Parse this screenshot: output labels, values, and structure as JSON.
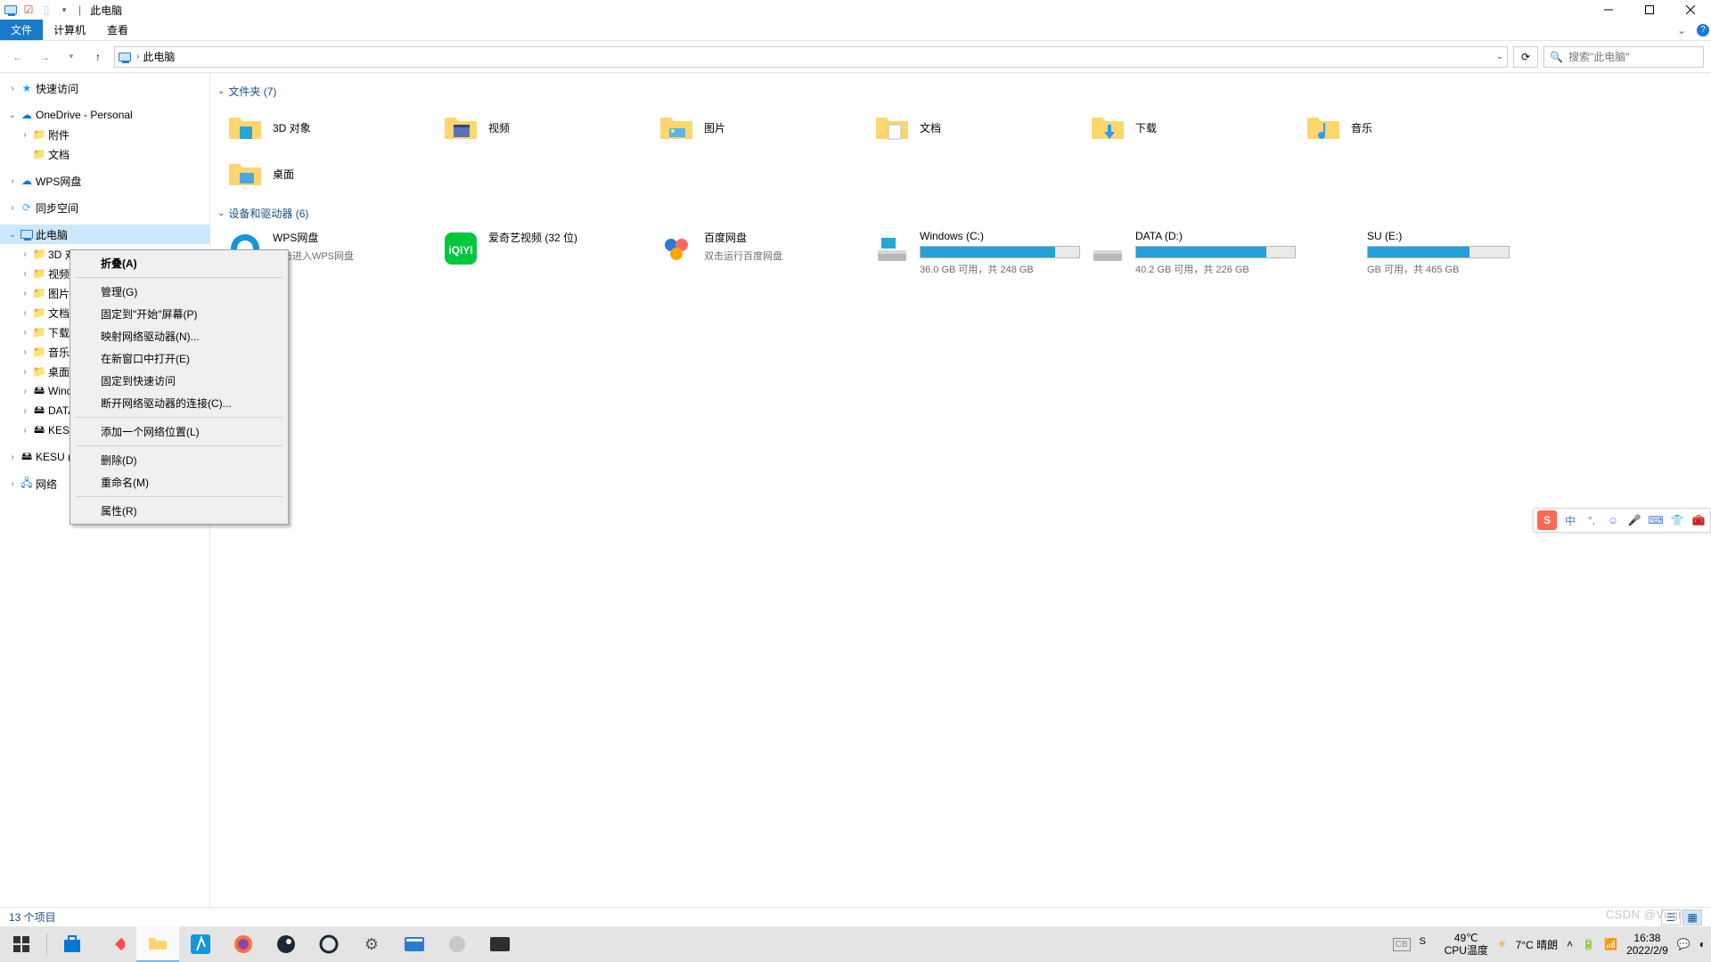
{
  "window": {
    "title": "此电脑",
    "separator": "|"
  },
  "winctl": {
    "min": "min",
    "max": "max",
    "close": "close"
  },
  "ribbon": {
    "file": "文件",
    "computer": "计算机",
    "view": "查看"
  },
  "addr": {
    "location": "此电脑",
    "search_placeholder": "搜索\"此电脑\""
  },
  "tree": {
    "quick": "快速访问",
    "onedrive": "OneDrive - Personal",
    "od_items": [
      "附件",
      "文档"
    ],
    "wps": "WPS网盘",
    "sync": "同步空间",
    "thispc": "此电脑",
    "pc_items": [
      "3D 对",
      "视频",
      "图片",
      "文档",
      "下载",
      "音乐",
      "桌面",
      "Wind",
      "DATA",
      "KESU"
    ],
    "kesu_ext": "KESU (",
    "network": "网络"
  },
  "groups": {
    "folders": "文件夹 (7)",
    "devices": "设备和驱动器 (6)"
  },
  "folders": [
    {
      "label": "3D 对象",
      "icon": "3d"
    },
    {
      "label": "视频",
      "icon": "video"
    },
    {
      "label": "图片",
      "icon": "pictures"
    },
    {
      "label": "文档",
      "icon": "docs"
    },
    {
      "label": "下载",
      "icon": "downloads"
    },
    {
      "label": "音乐",
      "icon": "music"
    },
    {
      "label": "桌面",
      "icon": "desktop"
    }
  ],
  "apps": [
    {
      "name": "WPS网盘",
      "sub": "双击进入WPS网盘",
      "icon": "wps"
    },
    {
      "name": "爱奇艺视频 (32 位)",
      "sub": "",
      "icon": "iqiyi"
    },
    {
      "name": "百度网盘",
      "sub": "双击运行百度网盘",
      "icon": "baidu"
    }
  ],
  "drives": [
    {
      "name": "Windows (C:)",
      "free": "36.0 GB 可用，共 248 GB",
      "pct": 85
    },
    {
      "name": "DATA (D:)",
      "free": "40.2 GB 可用，共 226 GB",
      "pct": 82
    },
    {
      "name": "SU (E:)",
      "free": "GB 可用，共 465 GB",
      "pct": 72,
      "partial_label": "SU (E:)",
      "partial_free": " GB 可用，共 465 GB"
    }
  ],
  "context_menu": [
    {
      "t": "折叠(A)",
      "bold": true
    },
    {
      "sep": true
    },
    {
      "t": "管理(G)"
    },
    {
      "t": "固定到\"开始\"屏幕(P)"
    },
    {
      "t": "映射网络驱动器(N)..."
    },
    {
      "t": "在新窗口中打开(E)"
    },
    {
      "t": "固定到快速访问"
    },
    {
      "t": "断开网络驱动器的连接(C)..."
    },
    {
      "sep": true
    },
    {
      "t": "添加一个网络位置(L)"
    },
    {
      "sep": true
    },
    {
      "t": "删除(D)"
    },
    {
      "t": "重命名(M)"
    },
    {
      "sep": true
    },
    {
      "t": "属性(R)"
    }
  ],
  "status": {
    "count": "13 个项目"
  },
  "tray": {
    "temp": "49℃",
    "cpu": "CPU温度",
    "weather": "7°C  晴朗",
    "time": "16:38",
    "date": "2022/2/9"
  },
  "ime": {
    "brand": "S",
    "ch": "中"
  },
  "watermark": "CSDN @Virgil"
}
